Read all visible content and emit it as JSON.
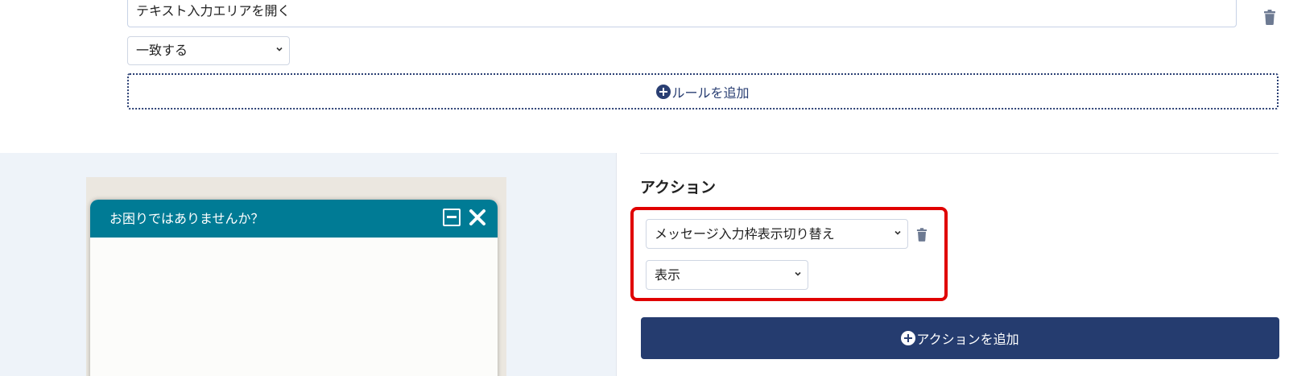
{
  "rule": {
    "text_value": "テキスト入力エリアを開く",
    "match_select": "一致する",
    "add_rule_label": "ルールを追加"
  },
  "preview": {
    "chat_title": "お困りではありませんか？"
  },
  "action": {
    "heading": "アクション",
    "type_select": "メッセージ入力枠表示切り替え",
    "value_select": "表示",
    "add_action_label": "アクションを追加"
  },
  "colors": {
    "primary": "#253c6f",
    "chat_header": "#007b95",
    "highlight": "#e00000",
    "trash": "#6d7a92"
  },
  "icons": [
    "trash-icon",
    "plus-circle-icon",
    "chevron-down-icon",
    "minimize-icon",
    "close-icon"
  ]
}
